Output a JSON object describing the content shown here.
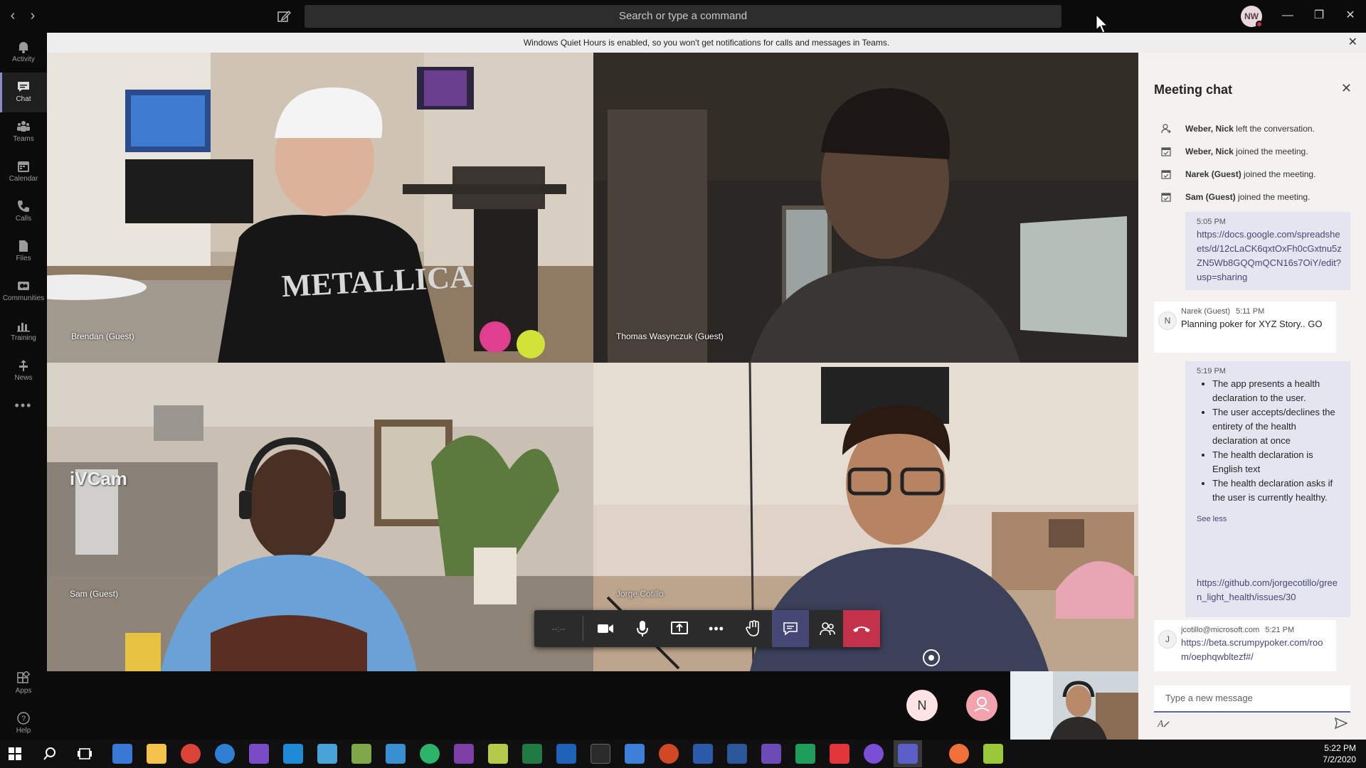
{
  "titlebar": {
    "search_placeholder": "Search or type a command",
    "user_initials": "NW",
    "minimize": "—",
    "maximize": "❐",
    "close": "✕"
  },
  "rail": [
    {
      "label": "Activity",
      "icon": "bell-icon"
    },
    {
      "label": "Chat",
      "icon": "chat-icon",
      "active": true
    },
    {
      "label": "Teams",
      "icon": "teams-icon"
    },
    {
      "label": "Calendar",
      "icon": "calendar-icon"
    },
    {
      "label": "Calls",
      "icon": "phone-icon"
    },
    {
      "label": "Files",
      "icon": "file-icon"
    },
    {
      "label": "Communities",
      "icon": "communities-icon"
    },
    {
      "label": "Training",
      "icon": "training-icon"
    },
    {
      "label": "News",
      "icon": "news-icon"
    },
    {
      "label": "Apps",
      "icon": "apps-icon"
    },
    {
      "label": "Help",
      "icon": "help-icon"
    }
  ],
  "notice": {
    "text": "Windows Quiet Hours is enabled, so you won't get notifications for calls and messages in Teams."
  },
  "participants": {
    "p1": "Brendan (Guest)",
    "p2": "Thomas Wasynczuk (Guest)",
    "p3": "Sam (Guest)",
    "p4": "Jorge Cotillo",
    "watermark": "iVCam"
  },
  "controls": {
    "timer": "--:--"
  },
  "bottom": {
    "bubble_n": "N"
  },
  "chat": {
    "title": "Meeting chat",
    "system": [
      {
        "name": "Weber, Nick",
        "text": " left the conversation."
      },
      {
        "name": "Weber, Nick",
        "text": " joined the meeting."
      },
      {
        "name": "Narek (Guest)",
        "text": " joined the meeting."
      },
      {
        "name": "Sam (Guest)",
        "text": " joined the meeting."
      }
    ],
    "m1": {
      "time": "5:05 PM",
      "link": "https://docs.google.com/spreadsheets/d/12cLaCK6qxtOxFh0cGxtnu5zZN5Wb8GQQmQCN16s7OiY/edit?usp=sharing"
    },
    "m2": {
      "author": "Narek (Guest)",
      "time": "5:11 PM",
      "text": "Planning poker for XYZ Story.. GO",
      "initial": "N"
    },
    "m3": {
      "time": "5:19 PM",
      "bullets": [
        "The app presents a health declaration to the user.",
        "The user accepts/declines the entirety of the health declaration at once",
        "The health declaration is English text",
        "The health declaration asks if the user is currently healthy."
      ],
      "see_less": "See less"
    },
    "m4": {
      "link": "https://github.com/jorgecotillo/green_light_health/issues/30"
    },
    "m5": {
      "author": "jcotillo@microsoft.com",
      "time": "5:21 PM",
      "link": "https://beta.scrumpypoker.com/room/oephqwbltezf#/",
      "initial": "J"
    },
    "compose_placeholder": "Type a new message"
  },
  "taskbar": {
    "time": "5:22 PM",
    "date": "7/2/2020"
  }
}
